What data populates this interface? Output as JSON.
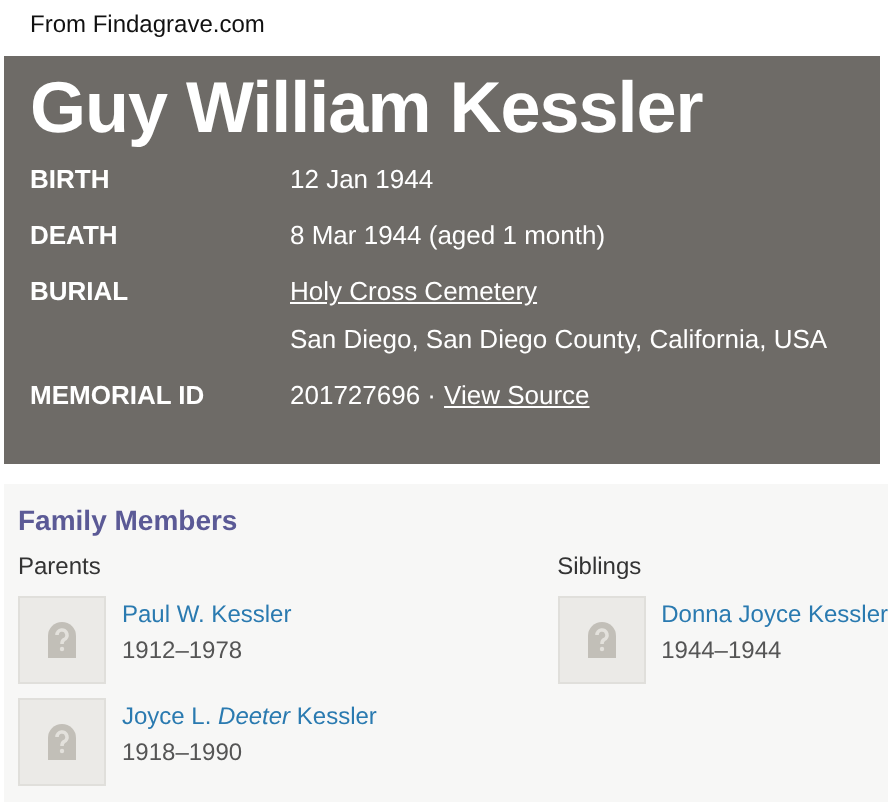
{
  "caption": "From Findagrave.com",
  "memorial": {
    "name": "Guy William Kessler",
    "rows": [
      {
        "label": "BIRTH",
        "lines": [
          [
            {
              "kind": "text",
              "text": "12 Jan 1944"
            }
          ]
        ]
      },
      {
        "label": "DEATH",
        "lines": [
          [
            {
              "kind": "text",
              "text": "8 Mar 1944 (aged 1 month)"
            }
          ]
        ]
      },
      {
        "label": "BURIAL",
        "lines": [
          [
            {
              "kind": "link",
              "text": "Holy Cross Cemetery"
            }
          ],
          [
            {
              "kind": "text",
              "text": "San Diego, San Diego County, California, USA"
            }
          ]
        ]
      },
      {
        "label": "MEMORIAL ID",
        "lines": [
          [
            {
              "kind": "text",
              "text": "201727696 ·"
            },
            {
              "kind": "link",
              "text": "View Source"
            }
          ]
        ]
      }
    ]
  },
  "family": {
    "title": "Family Members",
    "groups": [
      {
        "title": "Parents",
        "members": [
          {
            "name": "Paul W. Kessler",
            "years": "1912–1978"
          },
          {
            "name": "Joyce L. *Deeter* Kessler",
            "years": "1918–1990"
          }
        ]
      },
      {
        "title": "Siblings",
        "members": [
          {
            "name": "Donna Joyce Kessler",
            "years": "1944–1944"
          }
        ]
      }
    ]
  }
}
